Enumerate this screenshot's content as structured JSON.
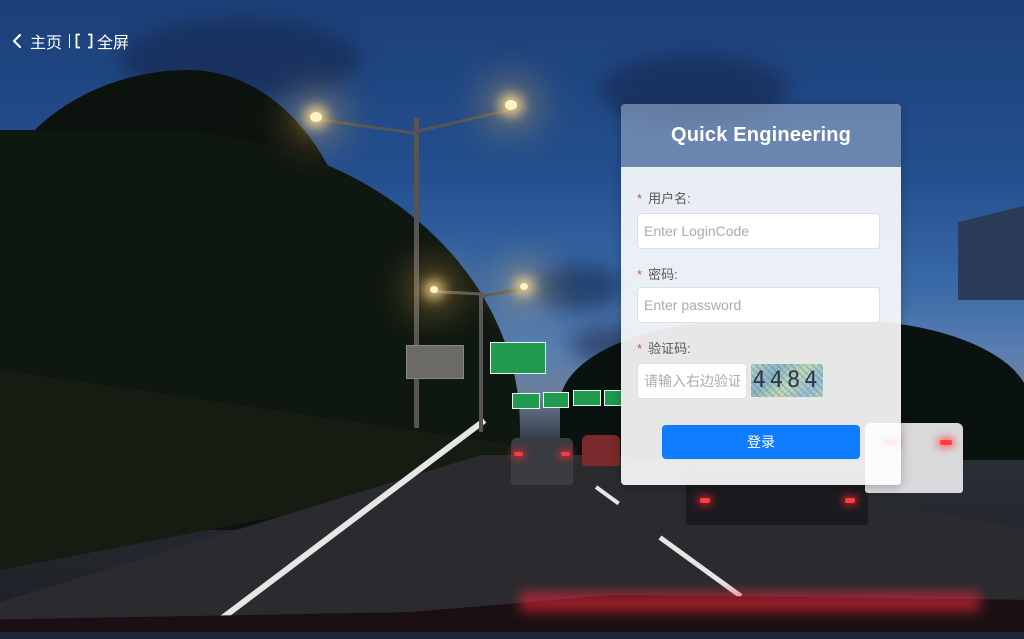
{
  "nav": {
    "home_label": "主页",
    "fullscreen_label": "全屏"
  },
  "login": {
    "title": "Quick Engineering",
    "username": {
      "label": "用户名:",
      "placeholder": "Enter LoginCode",
      "value": ""
    },
    "password": {
      "label": "密码:",
      "placeholder": "Enter password",
      "value": ""
    },
    "captcha": {
      "label": "验证码:",
      "placeholder": "请输入右边验证码",
      "value": "",
      "image_text": "4484"
    },
    "required_mark": "*",
    "submit_label": "登录"
  },
  "colors": {
    "primary_button": "#0f7bff",
    "required_mark": "#f04a3a",
    "card_header": "#96aac8"
  }
}
